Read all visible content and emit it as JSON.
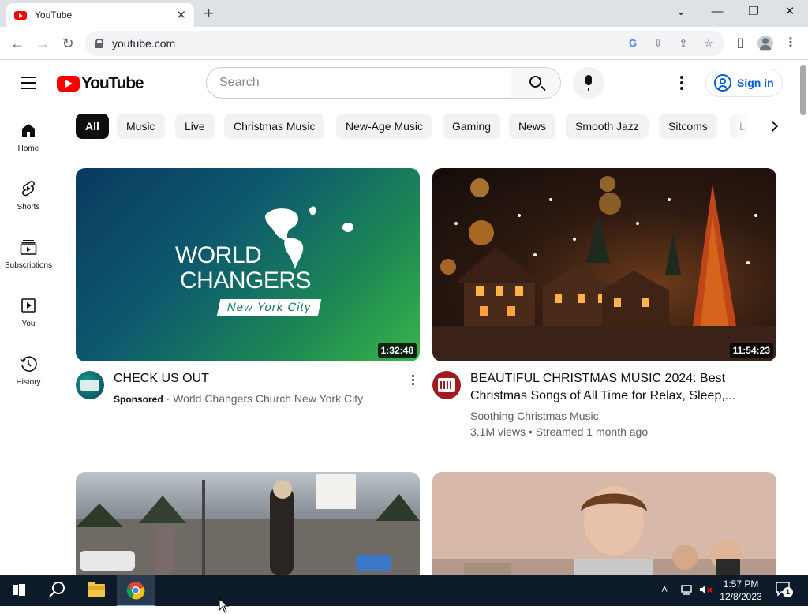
{
  "browser": {
    "tab_title": "YouTube",
    "url": "youtube.com"
  },
  "masthead": {
    "logo_text": "YouTube",
    "search_placeholder": "Search",
    "signin_label": "Sign in"
  },
  "guide": {
    "items": [
      {
        "label": "Home",
        "icon": "home-icon"
      },
      {
        "label": "Shorts",
        "icon": "shorts-icon"
      },
      {
        "label": "Subscriptions",
        "icon": "subscriptions-icon"
      },
      {
        "label": "You",
        "icon": "you-icon"
      },
      {
        "label": "History",
        "icon": "history-icon"
      }
    ]
  },
  "chips": [
    "All",
    "Music",
    "Live",
    "Christmas Music",
    "New-Age Music",
    "Gaming",
    "News",
    "Smooth Jazz",
    "Sitcoms",
    "L"
  ],
  "videos": [
    {
      "thumb_text_1": "WORLD",
      "thumb_text_2": "CHANGERS",
      "thumb_text_3": "New York City",
      "duration": "1:32:48",
      "title": "CHECK US OUT",
      "badge": "Sponsored",
      "separator": "·",
      "channel": "World Changers Church New York City"
    },
    {
      "duration": "11:54:23",
      "title_line_1": "BEAUTIFUL CHRISTMAS MUSIC 2024: Best",
      "title_line_2": "Christmas Songs of All Time for Relax, Sleep,...",
      "channel": "Soothing Christmas Music",
      "stats": "3.1M views • Streamed 1 month ago"
    }
  ],
  "taskbar": {
    "time": "1:57 PM",
    "date": "12/8/2023",
    "notification_count": "1"
  }
}
